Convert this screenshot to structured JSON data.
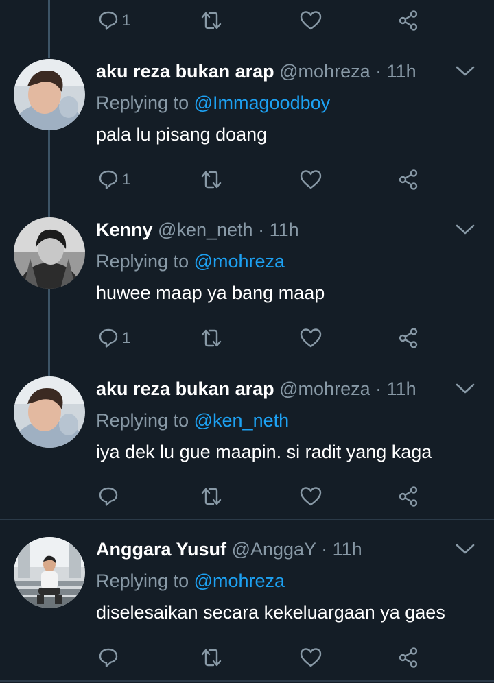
{
  "top_actions": {
    "reply_count": "1"
  },
  "tweets": [
    {
      "name": "aku reza bukan arap",
      "handle": "@mohreza",
      "dot": "·",
      "time": "11h",
      "replying_prefix": "Replying to",
      "replying_to": "@Immagoodboy",
      "text": "pala lu pisang doang",
      "reply_count": "1"
    },
    {
      "name": "Kenny",
      "handle": "@ken_neth",
      "dot": "·",
      "time": "11h",
      "replying_prefix": "Replying to",
      "replying_to": "@mohreza",
      "text": "huwee maap ya bang maap",
      "reply_count": "1"
    },
    {
      "name": "aku reza bukan arap",
      "handle": "@mohreza",
      "dot": "·",
      "time": "11h",
      "replying_prefix": "Replying to",
      "replying_to": "@ken_neth",
      "text": "iya dek lu gue maapin. si radit yang kaga",
      "reply_count": ""
    },
    {
      "name": "Anggara Yusuf",
      "handle": "@AnggaY",
      "dot": "·",
      "time": "11h",
      "replying_prefix": "Replying to",
      "replying_to": "@mohreza",
      "text": "diselesaikan secara kekeluargaan ya gaes",
      "reply_count": ""
    }
  ],
  "icons": {
    "reply": "reply-icon",
    "retweet": "retweet-icon",
    "like": "heart-icon",
    "share": "share-icon",
    "more": "chevron-down-icon"
  },
  "colors": {
    "background": "#141d26",
    "muted": "#8899a6",
    "mention": "#1da1f2",
    "thread_line": "#3d5466"
  }
}
